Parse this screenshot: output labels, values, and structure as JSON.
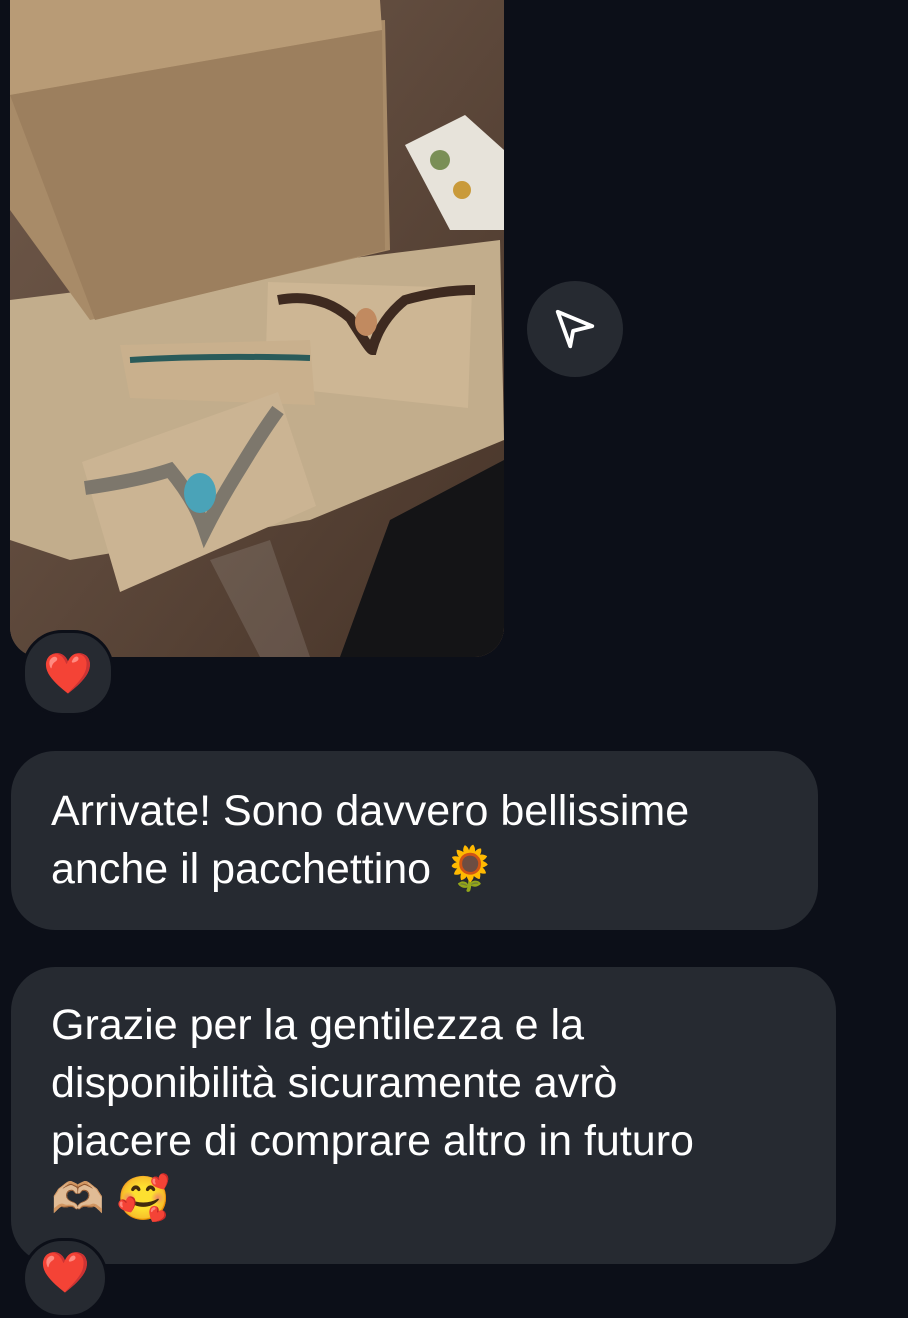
{
  "colors": {
    "background": "#0c0f18",
    "bubble": "#262a31",
    "text": "#ffffff",
    "heart": "#e8203a"
  },
  "photo": {
    "icon": "shared-photo-image"
  },
  "share_button": {
    "icon": "send-paper-plane-icon"
  },
  "reactions": [
    {
      "emoji": "❤️"
    },
    {
      "emoji": "❤️"
    }
  ],
  "messages": [
    {
      "lines": [
        "Arrivate! Sono davvero bellissime",
        "anche il pacchettino 🌻"
      ]
    },
    {
      "lines": [
        "Grazie per la gentilezza e la",
        "disponibilità sicuramente avrò",
        "piacere di comprare altro in futuro",
        "🫶🏼 🥰"
      ]
    }
  ]
}
